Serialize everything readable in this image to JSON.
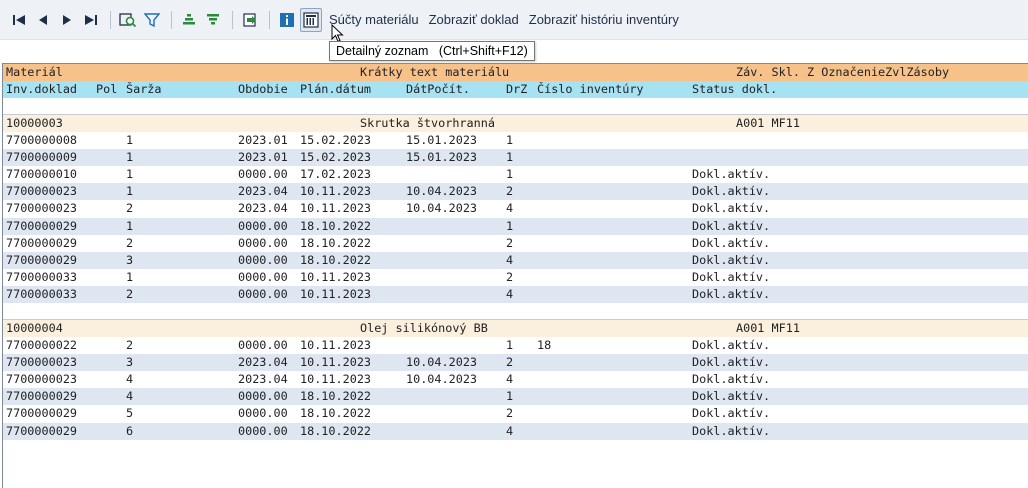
{
  "toolbar": {
    "first_label": "◀◀",
    "prev_label": "◀",
    "next_label": "▶",
    "last_label": "▶▶",
    "text_buttons": {
      "material_totals": "Súčty materiálu",
      "display_document": "Zobraziť doklad",
      "display_history": "Zobraziť históriu inventúry"
    }
  },
  "tooltip": {
    "text": "Detailný zoznam   (Ctrl+Shift+F12)"
  },
  "list": {
    "header1": {
      "material": "Materiál",
      "short_text": "Krátky text materiálu",
      "rest": "Záv. Skl. Z OznačenieZvlZásoby"
    },
    "header2": {
      "inv_doc": "Inv.doklad",
      "item": "Pol",
      "batch": "Šarža",
      "period": "Obdobie",
      "plan_date": "Plán.dátum",
      "count_date": "DátPočít.",
      "type": "DrZ",
      "inv_number": "Číslo inventúry",
      "status": "Status dokl."
    },
    "groups": [
      {
        "material": "10000003",
        "text": "Skrutka štvorhranná",
        "plant_sloc": "A001 MF11",
        "rows": [
          {
            "doc": "7700000008",
            "item": "1",
            "period": "2023.01",
            "plan": "15.02.2023",
            "count": "15.01.2023",
            "type": "1",
            "invnum": "",
            "status": ""
          },
          {
            "doc": "7700000009",
            "item": "1",
            "period": "2023.01",
            "plan": "15.02.2023",
            "count": "15.01.2023",
            "type": "1",
            "invnum": "",
            "status": ""
          },
          {
            "doc": "7700000010",
            "item": "1",
            "period": "0000.00",
            "plan": "17.02.2023",
            "count": "",
            "type": "1",
            "invnum": "",
            "status": "Dokl.aktív."
          },
          {
            "doc": "7700000023",
            "item": "1",
            "period": "2023.04",
            "plan": "10.11.2023",
            "count": "10.04.2023",
            "type": "2",
            "invnum": "",
            "status": "Dokl.aktív."
          },
          {
            "doc": "7700000023",
            "item": "2",
            "period": "2023.04",
            "plan": "10.11.2023",
            "count": "10.04.2023",
            "type": "4",
            "invnum": "",
            "status": "Dokl.aktív."
          },
          {
            "doc": "7700000029",
            "item": "1",
            "period": "0000.00",
            "plan": "18.10.2022",
            "count": "",
            "type": "1",
            "invnum": "",
            "status": "Dokl.aktív."
          },
          {
            "doc": "7700000029",
            "item": "2",
            "period": "0000.00",
            "plan": "18.10.2022",
            "count": "",
            "type": "2",
            "invnum": "",
            "status": "Dokl.aktív."
          },
          {
            "doc": "7700000029",
            "item": "3",
            "period": "0000.00",
            "plan": "18.10.2022",
            "count": "",
            "type": "4",
            "invnum": "",
            "status": "Dokl.aktív."
          },
          {
            "doc": "7700000033",
            "item": "1",
            "period": "0000.00",
            "plan": "10.11.2023",
            "count": "",
            "type": "2",
            "invnum": "",
            "status": "Dokl.aktív."
          },
          {
            "doc": "7700000033",
            "item": "2",
            "period": "0000.00",
            "plan": "10.11.2023",
            "count": "",
            "type": "4",
            "invnum": "",
            "status": "Dokl.aktív."
          }
        ]
      },
      {
        "material": "10000004",
        "text": "Olej silikónový BB",
        "plant_sloc": "A001 MF11",
        "rows": [
          {
            "doc": "7700000022",
            "item": "2",
            "period": "0000.00",
            "plan": "10.11.2023",
            "count": "",
            "type": "1",
            "invnum": "18",
            "status": "Dokl.aktív."
          },
          {
            "doc": "7700000023",
            "item": "3",
            "period": "2023.04",
            "plan": "10.11.2023",
            "count": "10.04.2023",
            "type": "2",
            "invnum": "",
            "status": "Dokl.aktív."
          },
          {
            "doc": "7700000023",
            "item": "4",
            "period": "2023.04",
            "plan": "10.11.2023",
            "count": "10.04.2023",
            "type": "4",
            "invnum": "",
            "status": "Dokl.aktív."
          },
          {
            "doc": "7700000029",
            "item": "4",
            "period": "0000.00",
            "plan": "18.10.2022",
            "count": "",
            "type": "1",
            "invnum": "",
            "status": "Dokl.aktív."
          },
          {
            "doc": "7700000029",
            "item": "5",
            "period": "0000.00",
            "plan": "18.10.2022",
            "count": "",
            "type": "2",
            "invnum": "",
            "status": "Dokl.aktív."
          },
          {
            "doc": "7700000029",
            "item": "6",
            "period": "0000.00",
            "plan": "18.10.2022",
            "count": "",
            "type": "4",
            "invnum": "",
            "status": "Dokl.aktív."
          }
        ]
      }
    ]
  }
}
